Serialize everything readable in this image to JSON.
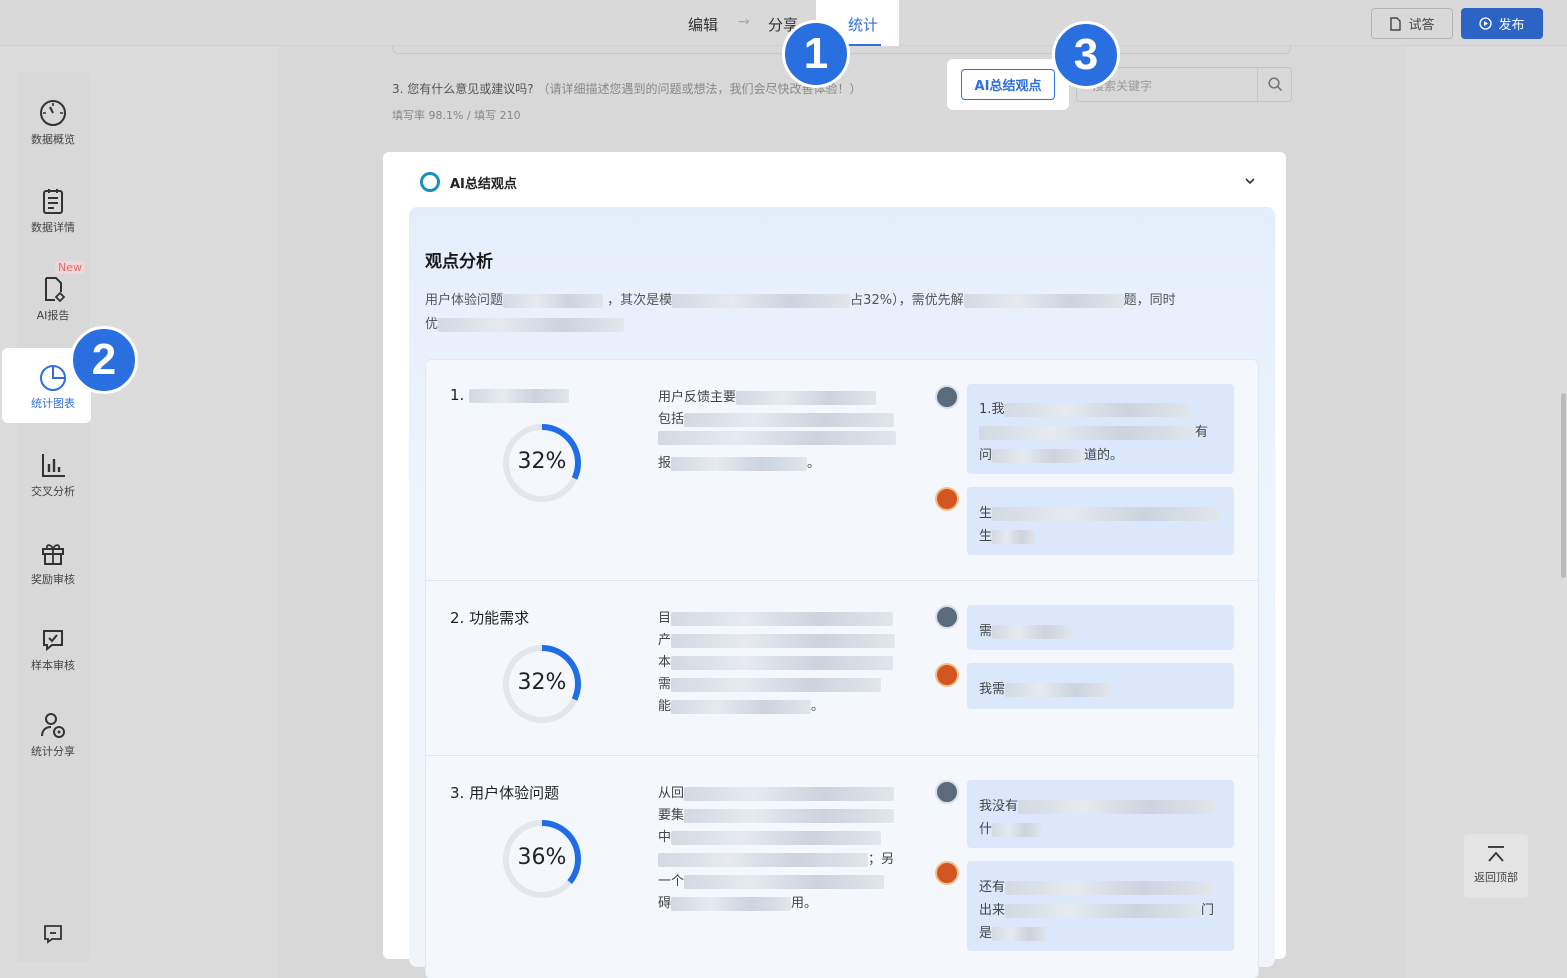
{
  "topbar": {
    "tabs": [
      "编辑",
      "分享",
      "统计"
    ],
    "active_tab": "统计",
    "try_label": "试答",
    "publish_label": "发布"
  },
  "sidebar": {
    "items": [
      {
        "label": "数据概览",
        "icon": "gauge-icon"
      },
      {
        "label": "数据详情",
        "icon": "clipboard-icon"
      },
      {
        "label": "AI报告",
        "icon": "file-ai-icon"
      },
      {
        "label": "统计图表",
        "icon": "pie-chart-icon"
      },
      {
        "label": "交叉分析",
        "icon": "bar-chart-icon"
      },
      {
        "label": "奖励审核",
        "icon": "gift-icon"
      },
      {
        "label": "样本审核",
        "icon": "check-message-icon"
      },
      {
        "label": "统计分享",
        "icon": "user-share-icon"
      }
    ],
    "new_badge": "New",
    "feedback_icon": "message-icon"
  },
  "steps": [
    "1",
    "2",
    "3"
  ],
  "question": {
    "title": "3. 您有什么意见或建议吗?",
    "hint": "（请详细描述您遇到的问题或想法，我们会尽快改善体验！）",
    "fill_rate": "填写率 98.1% / 填写 210"
  },
  "ai_button": "AI总结观点",
  "search": {
    "placeholder": "搜索关键字"
  },
  "panel": {
    "title": "AI总结观点",
    "analysis_title": "观点分析",
    "summary": {
      "line1_a": "用户体验问题",
      "line1_b": "，其次是模",
      "line1_c": "占32%），需优先解",
      "line1_d": "题，同时",
      "line2_a": "优"
    },
    "rows": [
      {
        "title": "1.",
        "percent": 32,
        "percent_label": "32%",
        "desc": [
          "用户反馈主要",
          "包括",
          "",
          "报"
        ],
        "quotes": [
          {
            "lines": [
              "1.我",
              "",
              "问"
            ],
            "tails": [
              "",
              "有",
              "道的。"
            ]
          },
          {
            "lines": [
              "生",
              "生"
            ],
            "tails": [
              "",
              ""
            ]
          }
        ]
      },
      {
        "title": "2. 功能需求",
        "percent": 32,
        "percent_label": "32%",
        "desc": [
          "目",
          "产",
          "本",
          "需",
          "能"
        ],
        "quotes": [
          {
            "lines": [
              "需"
            ],
            "tails": [
              ""
            ]
          },
          {
            "lines": [
              "我需"
            ],
            "tails": [
              ""
            ]
          }
        ]
      },
      {
        "title": "3. 用户体验问题",
        "percent": 36,
        "percent_label": "36%",
        "desc": [
          "从回",
          "要集",
          "中",
          "",
          "一个",
          "碍"
        ],
        "quotes": [
          {
            "lines": [
              "我没有",
              "什"
            ],
            "tails": [
              "",
              ""
            ]
          },
          {
            "lines": [
              "还有",
              "出来",
              "是"
            ],
            "tails": [
              "",
              "门",
              ""
            ]
          }
        ]
      }
    ]
  },
  "back_to_top": "返回顶部",
  "colors": {
    "accent": "#2f6fdc",
    "step": "#2a6fe0",
    "bubble": "#dbe8fb"
  }
}
